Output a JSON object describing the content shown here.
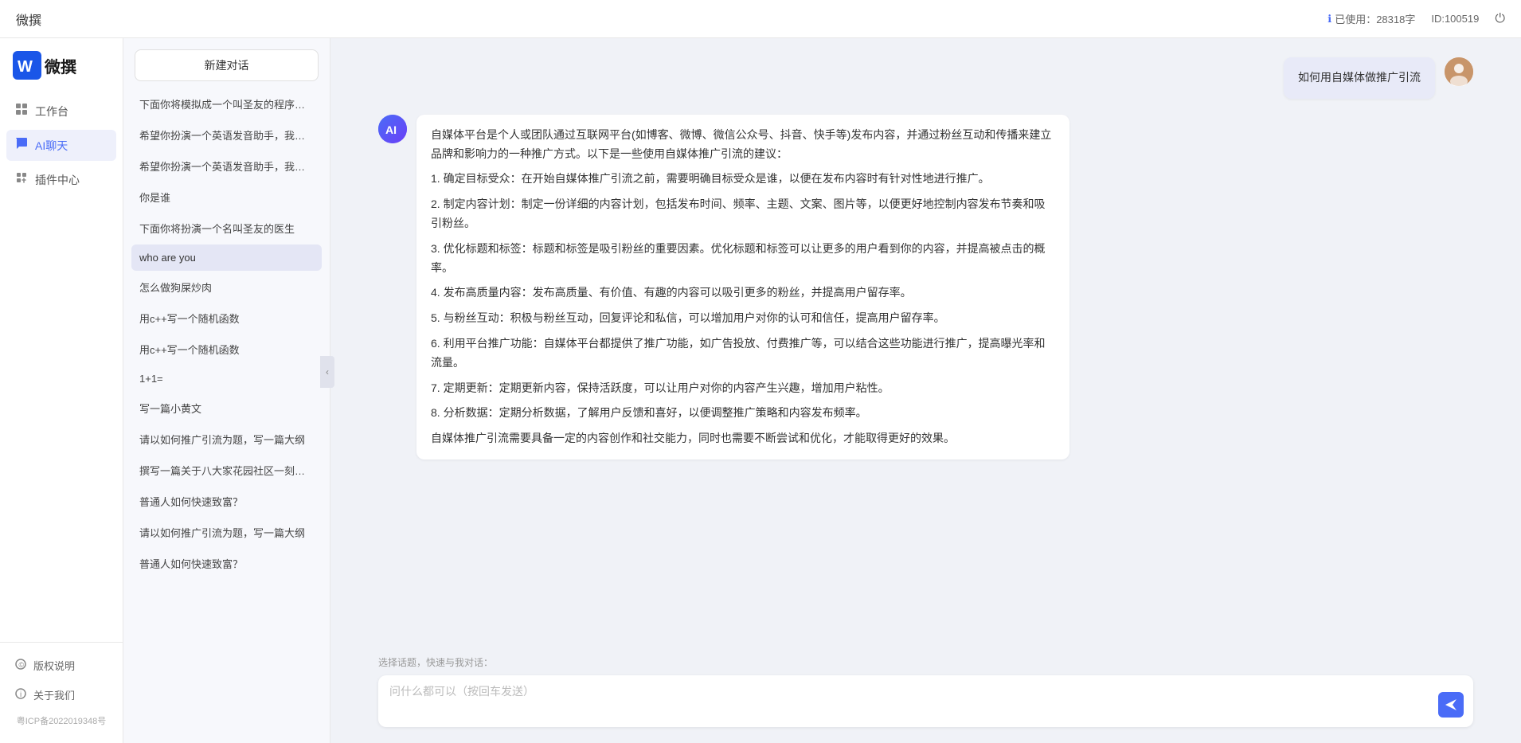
{
  "topbar": {
    "title": "微撰",
    "usage_label": "已使用：28318字",
    "id_label": "ID:100519",
    "usage_icon": "ℹ",
    "power_icon": "⏻"
  },
  "sidebar": {
    "logo_text": "微撰",
    "nav_items": [
      {
        "id": "workbench",
        "label": "工作台",
        "icon": "⊞"
      },
      {
        "id": "ai-chat",
        "label": "AI聊天",
        "icon": "💬",
        "active": true
      },
      {
        "id": "plugin",
        "label": "插件中心",
        "icon": "🔌"
      }
    ],
    "bottom_items": [
      {
        "id": "copyright",
        "label": "版权说明",
        "icon": "©"
      },
      {
        "id": "about",
        "label": "关于我们",
        "icon": "ℹ"
      }
    ],
    "icp": "粤ICP备2022019348号"
  },
  "conv_panel": {
    "new_chat_label": "新建对话",
    "conversations": [
      {
        "id": 1,
        "text": "下面你将模拟成一个叫圣友的程序员，我说...",
        "active": false
      },
      {
        "id": 2,
        "text": "希望你扮演一个英语发音助手，我提供给你...",
        "active": false
      },
      {
        "id": 3,
        "text": "希望你扮演一个英语发音助手，我提供给你...",
        "active": false
      },
      {
        "id": 4,
        "text": "你是谁",
        "active": false
      },
      {
        "id": 5,
        "text": "下面你将扮演一个名叫圣友的医生",
        "active": false
      },
      {
        "id": 6,
        "text": "who are you",
        "active": true
      },
      {
        "id": 7,
        "text": "怎么做狗屎炒肉",
        "active": false
      },
      {
        "id": 8,
        "text": "用c++写一个随机函数",
        "active": false
      },
      {
        "id": 9,
        "text": "用c++写一个随机函数",
        "active": false
      },
      {
        "id": 10,
        "text": "1+1=",
        "active": false
      },
      {
        "id": 11,
        "text": "写一篇小黄文",
        "active": false
      },
      {
        "id": 12,
        "text": "请以如何推广引流为题，写一篇大纲",
        "active": false
      },
      {
        "id": 13,
        "text": "撰写一篇关于八大家花园社区一刻钟便民生...",
        "active": false
      },
      {
        "id": 14,
        "text": "普通人如何快速致富？",
        "active": false
      },
      {
        "id": 15,
        "text": "请以如何推广引流为题，写一篇大纲",
        "active": false
      },
      {
        "id": 16,
        "text": "普通人如何快速致富？",
        "active": false
      }
    ]
  },
  "chat": {
    "messages": [
      {
        "id": 1,
        "type": "user",
        "avatar_text": "用户",
        "text": "如何用自媒体做推广引流"
      },
      {
        "id": 2,
        "type": "ai",
        "avatar_text": "AI",
        "paragraphs": [
          "自媒体平台是个人或团队通过互联网平台(如博客、微博、微信公众号、抖音、快手等)发布内容，并通过粉丝互动和传播来建立品牌和影响力的一种推广方式。以下是一些使用自媒体推广引流的建议：",
          "1. 确定目标受众：在开始自媒体推广引流之前，需要明确目标受众是谁，以便在发布内容时有针对性地进行推广。",
          "2. 制定内容计划：制定一份详细的内容计划，包括发布时间、频率、主题、文案、图片等，以便更好地控制内容发布节奏和吸引粉丝。",
          "3. 优化标题和标签：标题和标签是吸引粉丝的重要因素。优化标题和标签可以让更多的用户看到你的内容，并提高被点击的概率。",
          "4. 发布高质量内容：发布高质量、有价值、有趣的内容可以吸引更多的粉丝，并提高用户留存率。",
          "5. 与粉丝互动：积极与粉丝互动，回复评论和私信，可以增加用户对你的认可和信任，提高用户留存率。",
          "6. 利用平台推广功能：自媒体平台都提供了推广功能，如广告投放、付费推广等，可以结合这些功能进行推广，提高曝光率和流量。",
          "7. 定期更新：定期更新内容，保持活跃度，可以让用户对你的内容产生兴趣，增加用户粘性。",
          "8. 分析数据：定期分析数据，了解用户反馈和喜好，以便调整推广策略和内容发布频率。",
          "自媒体推广引流需要具备一定的内容创作和社交能力，同时也需要不断尝试和优化，才能取得更好的效果。"
        ]
      }
    ],
    "quick_topics_label": "选择话题，快速与我对话：",
    "input_placeholder": "问什么都可以（按回车发送）",
    "send_icon": "➤"
  }
}
